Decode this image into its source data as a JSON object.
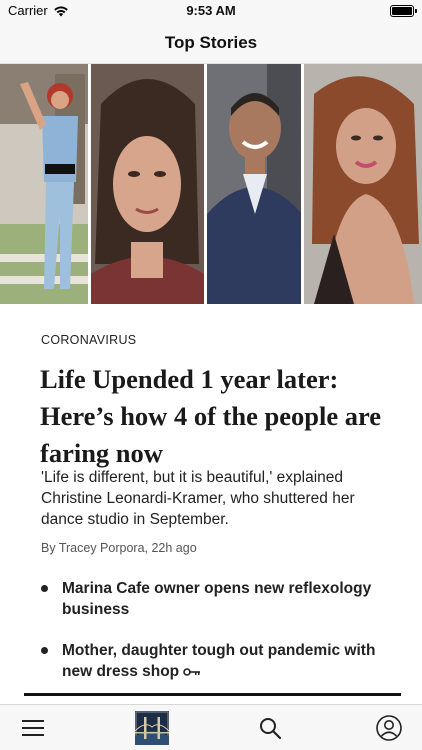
{
  "status_bar": {
    "carrier": "Carrier",
    "time": "9:53 AM"
  },
  "nav": {
    "title": "Top Stories"
  },
  "article": {
    "kicker": "CORONAVIRUS",
    "headline": "Life Upended 1 year later: Here’s how 4 of the people are faring now",
    "dek": "'Life is different, but it is beautiful,' explained Christine Leonardi-Kramer, who shuttered her dance studio in September.",
    "byline": "By Tracey Porpora, 22h ago",
    "photos": [
      "photo-woman-waving",
      "photo-woman-closeup",
      "photo-man-smiling",
      "photo-woman-dancer"
    ]
  },
  "related": [
    {
      "title": "Marina Cafe owner opens new reflexology business",
      "premium": false
    },
    {
      "title": "Mother, daughter tough out pandemic with new dress shop",
      "premium": true
    }
  ],
  "tab_bar": {
    "icons": [
      "hamburger-menu-icon",
      "app-logo-icon",
      "search-icon",
      "account-icon"
    ]
  },
  "colors": {
    "bar_background": "#f7f7f7",
    "text": "#111111",
    "rule": "#111111"
  }
}
